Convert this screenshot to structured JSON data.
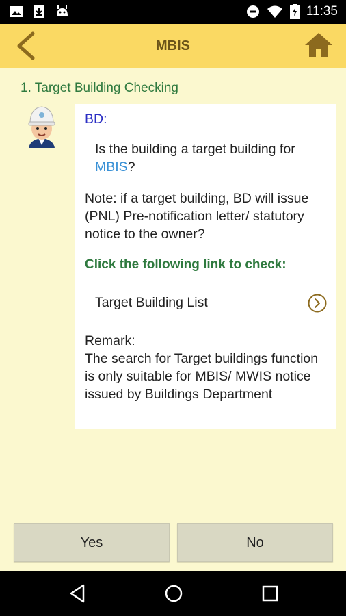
{
  "status_bar": {
    "time": "11:35",
    "icons": [
      "image-icon",
      "download-icon",
      "android-icon",
      "do-not-disturb-icon",
      "wifi-icon",
      "battery-charging-icon"
    ]
  },
  "app_bar": {
    "title": "MBIS",
    "back_icon": "chevron-left-icon",
    "home_icon": "home-icon"
  },
  "section": {
    "title": "1. Target Building Checking"
  },
  "card": {
    "speaker": "BD:",
    "question_prefix": "Is the building a target building for ",
    "question_link": "MBIS",
    "question_suffix": "?",
    "note": "Note: if a target building, BD will issue (PNL) Pre-notification letter/ statutory notice to the owner?",
    "check_heading": "Click the following link to check:",
    "link_label": "Target Building List",
    "remark_title": "Remark:",
    "remark_body": "The search for Target buildings function is only suitable for MBIS/ MWIS notice issued by Buildings Department"
  },
  "buttons": {
    "yes": "Yes",
    "no": "No"
  },
  "colors": {
    "app_bar": "#fad963",
    "background": "#fbf8cf",
    "accent_green": "#2f7a3f",
    "speaker_blue": "#2b2fc4",
    "link_blue": "#3a91d6"
  }
}
